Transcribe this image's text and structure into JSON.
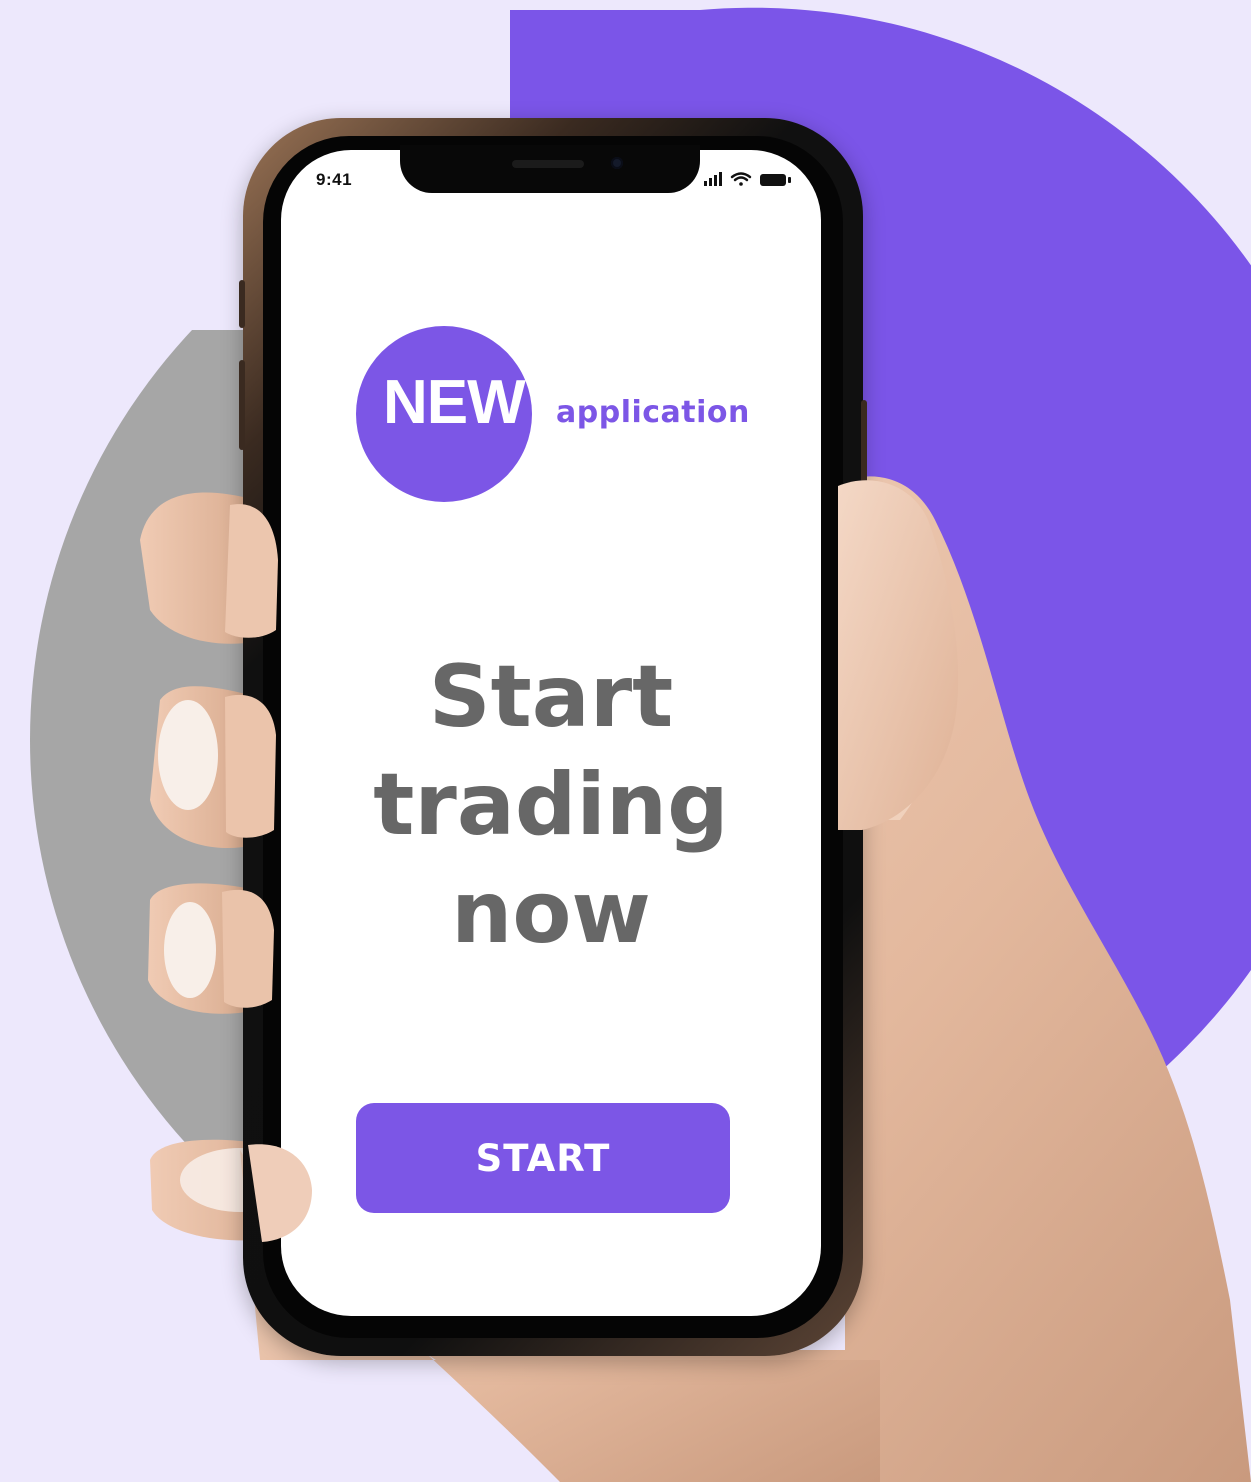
{
  "status_bar": {
    "time": "9:41",
    "icons": [
      "signal-icon",
      "wifi-icon",
      "battery-icon"
    ]
  },
  "logo": {
    "badge_text": "NEW",
    "suffix_text": "application"
  },
  "headline": {
    "line1": "Start",
    "line2": "trading",
    "line3": "now"
  },
  "cta": {
    "label": "START"
  },
  "colors": {
    "background": "#ede8fc",
    "accent": "#7c56e6",
    "grey_circle": "#a6a6a6",
    "headline_text": "#676767",
    "button_text": "#ffffff"
  }
}
